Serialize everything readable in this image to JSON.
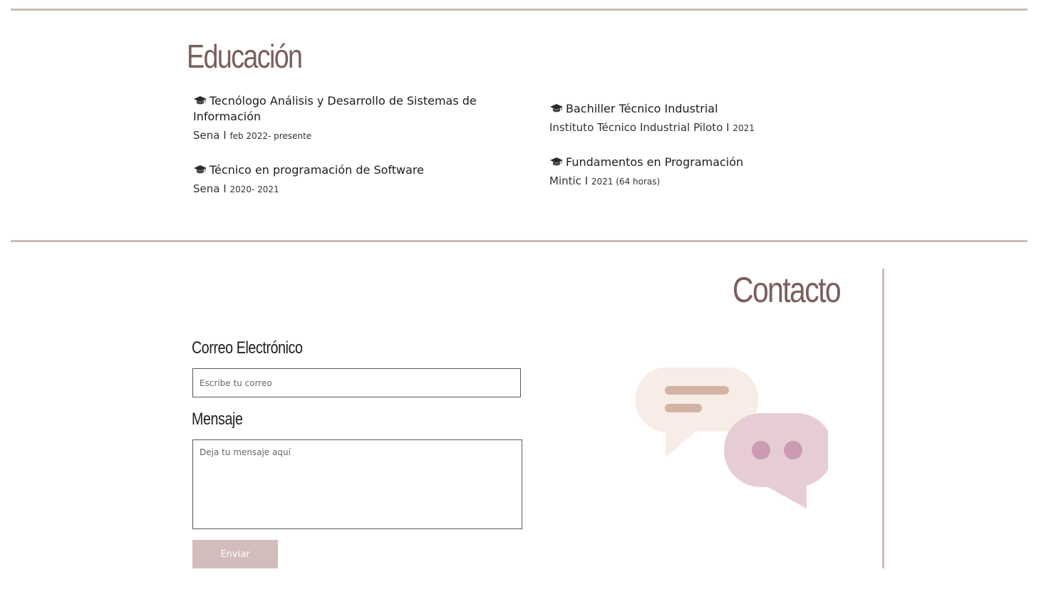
{
  "education": {
    "title": "Educación",
    "items": [
      {
        "name": "Tecnólogo Análisis y Desarrollo de Sistemas de Información",
        "institution": "Sena",
        "separator": "I",
        "period": "feb 2022- presente"
      },
      {
        "name": "Técnico en programación de Software",
        "institution": "Sena",
        "separator": "I",
        "period": "2020- 2021"
      },
      {
        "name": "Bachiller Técnico Industrial",
        "institution": "Instituto Técnico Industrial Piloto",
        "separator": "I",
        "period": "2021"
      },
      {
        "name": "Fundamentos en Programación",
        "institution": "Mintic",
        "separator": "I",
        "period": "2021 (64 horas)"
      }
    ]
  },
  "contact": {
    "title": "Contacto",
    "email_label": "Correo Electrónico",
    "email_placeholder": "Escribe tu correo",
    "message_label": "Mensaje",
    "message_placeholder": "Deja tu mensaje aquí",
    "send_label": "Enviar"
  },
  "colors": {
    "heading": "#7a5f5d",
    "rule": "#cbbcb8",
    "button": "#d2bcbc",
    "bubble_light": "#f7ede6",
    "bubble_light_lines": "#d2b3a4",
    "bubble_pink": "#e6cdd5",
    "bubble_dots": "#cc9ab3"
  }
}
